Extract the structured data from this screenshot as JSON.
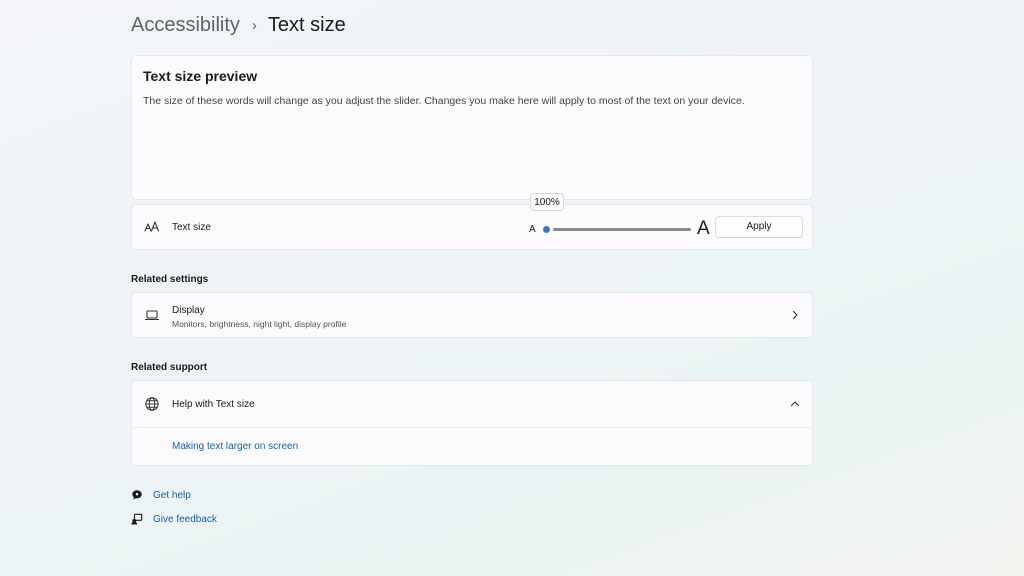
{
  "breadcrumb": {
    "parent": "Accessibility",
    "separator": "›",
    "current": "Text size"
  },
  "preview": {
    "title": "Text size preview",
    "description": "The size of these words will change as you adjust the slider. Changes you make here will apply to most of the text on your device."
  },
  "text_size": {
    "icon": "text-size-icon",
    "label": "Text size",
    "small_glyph": "A",
    "large_glyph": "A",
    "value_label": "100%",
    "value_percent": 100,
    "slider_min": 100,
    "slider_max": 225,
    "apply_label": "Apply"
  },
  "related_settings": {
    "heading": "Related settings",
    "items": [
      {
        "icon": "laptop-icon",
        "title": "Display",
        "subtitle": "Monitors, brightness, night light, display profile"
      }
    ]
  },
  "related_support": {
    "heading": "Related support",
    "help": {
      "icon": "globe-icon",
      "title": "Help with Text size",
      "links": [
        "Making text larger on screen"
      ]
    }
  },
  "footer": {
    "get_help": "Get help",
    "give_feedback": "Give feedback"
  },
  "colors": {
    "accent": "#3b78c0",
    "link": "#1a5fa6"
  }
}
